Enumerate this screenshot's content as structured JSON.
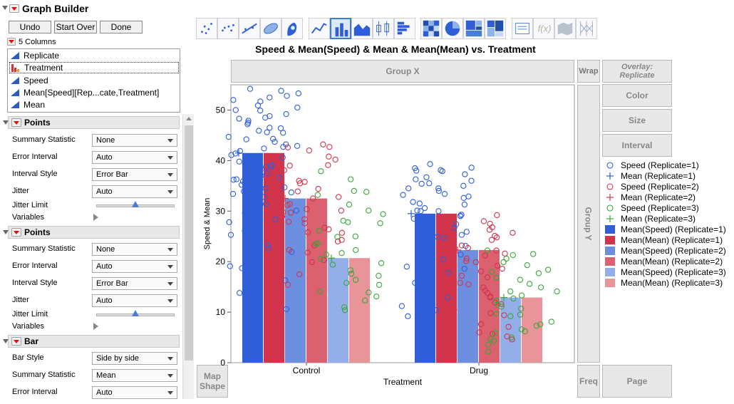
{
  "window": {
    "title": "Graph Builder"
  },
  "buttons": {
    "undo": "Undo",
    "start_over": "Start Over",
    "done": "Done"
  },
  "columns": {
    "header": "5 Columns",
    "items": [
      "Replicate",
      "Treatment",
      "Speed",
      "Mean[Speed][Rep...cate,Treatment]",
      "Mean"
    ]
  },
  "sections": [
    {
      "title": "Points",
      "rows": [
        {
          "label": "Summary Statistic",
          "value": "None"
        },
        {
          "label": "Error Interval",
          "value": "Auto"
        },
        {
          "label": "Interval Style",
          "value": "Error Bar"
        },
        {
          "label": "Jitter",
          "value": "Auto"
        }
      ],
      "jitter_limit_label": "Jitter Limit",
      "jitter_limit_level": 0.5,
      "variables_label": "Variables"
    },
    {
      "title": "Points",
      "rows": [
        {
          "label": "Summary Statistic",
          "value": "None"
        },
        {
          "label": "Error Interval",
          "value": "Auto"
        },
        {
          "label": "Interval Style",
          "value": "Error Bar"
        },
        {
          "label": "Jitter",
          "value": "Auto"
        }
      ],
      "jitter_limit_label": "Jitter Limit",
      "jitter_limit_level": 0.5,
      "variables_label": "Variables"
    },
    {
      "title": "Bar",
      "rows": [
        {
          "label": "Bar Style",
          "value": "Side by side"
        },
        {
          "label": "Summary Statistic",
          "value": "Mean"
        },
        {
          "label": "Error Interval",
          "value": "Auto"
        }
      ]
    }
  ],
  "toolbar_icons": [
    "points-icon",
    "jitter-points-icon",
    "line-of-fit-icon",
    "ellipse-icon",
    "contour-icon",
    "line-icon",
    "bar-icon",
    "area-icon",
    "box-plot-icon",
    "histogram-icon",
    "heatmap-icon",
    "pie-icon",
    "treemap-icon",
    "mosaic-icon",
    "caption-box-icon",
    "formula-icon",
    "map-shapes-icon",
    "parallel-icon"
  ],
  "drop_zones": {
    "group_x": "Group X",
    "wrap": "Wrap",
    "overlay": "Overlay:",
    "overlay_value": "Replicate",
    "color": "Color",
    "size": "Size",
    "interval": "Interval",
    "group_y": "Group Y",
    "map_shape_line1": "Map",
    "map_shape_line2": "Shape",
    "freq": "Freq",
    "page": "Page"
  },
  "colors": {
    "blue1": "#2f5ed8",
    "red1": "#d1344b",
    "blue2": "#6e8fe0",
    "red2": "#db6070",
    "blue3": "#94aeea",
    "red3": "#e89499",
    "green": "#3aa63a"
  },
  "chart_data": {
    "type": "bar",
    "title": "Speed & Mean(Speed) & Mean & Mean(Mean) vs. Treatment",
    "xlabel": "Treatment",
    "ylabel": "Speed & Mean",
    "categories": [
      "Control",
      "Drug"
    ],
    "ylim": [
      0,
      55
    ],
    "yticks": [
      0,
      10,
      20,
      30,
      40,
      50
    ],
    "series": [
      {
        "name": "Mean(Speed) (Replicate=1)",
        "values": [
          41.5,
          29.5
        ]
      },
      {
        "name": "Mean(Mean) (Replicate=1)",
        "values": [
          41.5,
          29.5
        ]
      },
      {
        "name": "Mean(Speed) (Replicate=2)",
        "values": [
          32.5,
          22.3
        ]
      },
      {
        "name": "Mean(Mean) (Replicate=2)",
        "values": [
          32.5,
          22.3
        ]
      },
      {
        "name": "Mean(Speed) (Replicate=3)",
        "values": [
          20.7,
          12.9
        ]
      },
      {
        "name": "Mean(Mean) (Replicate=3)",
        "values": [
          20.7,
          12.9
        ]
      }
    ],
    "points": [
      {
        "name": "Speed (Replicate=1)",
        "category": "Control",
        "values": [
          46.4,
          52.0,
          50.9,
          52.8,
          48.3,
          49.2,
          50.0,
          50.5,
          47.9,
          45.5,
          44.7,
          44.2,
          43.7,
          42.4,
          41.4,
          40.5,
          39.1,
          38.1,
          37.0,
          36.3,
          34.7,
          33.7,
          33.6,
          32.8,
          46.5,
          47.2,
          48.8,
          48.5,
          51.7,
          54.2,
          53.3,
          53.8,
          52.5,
          49.9,
          45.9,
          43.2,
          41.1,
          39.8,
          38.7,
          36.7,
          35.2,
          34.5,
          33.4,
          31.4,
          29.6,
          28.3,
          27.8,
          26.1,
          25.3,
          24.2,
          23.3,
          22.6,
          21.9,
          20.6,
          19.1,
          18.7,
          17.1,
          16.3,
          15.3,
          13.8,
          12.7,
          10.6,
          38.8,
          37.5,
          36.2,
          45.6,
          44.3,
          42.9,
          41.9,
          40.6,
          30.1,
          33.9,
          35.9,
          42.7,
          47.5
        ]
      },
      {
        "name": "Speed (Replicate=1)",
        "category": "Drug",
        "values": [
          38.1,
          36.7,
          35.4,
          34.0,
          34.5,
          33.2,
          37.3,
          38.5,
          39.3,
          38.6,
          36.3,
          34.5,
          32.9,
          31.3,
          31.5,
          30.0,
          29.1,
          27.9,
          29.3,
          28.1,
          27.4,
          27.3,
          26.7,
          25.9,
          24.9,
          24.7,
          22.2,
          21.4,
          20.4,
          19.0,
          17.8,
          15.8,
          14.4,
          12.9,
          11.2,
          10.4,
          9.2,
          37.9,
          38.0,
          36.0,
          35.5,
          32.6,
          31.8,
          30.6,
          30.0,
          28.5,
          26.6,
          25.3,
          23.1,
          19.8,
          18.6,
          33.4,
          35.0,
          30.1,
          29.0
        ]
      },
      {
        "name": "Mean (Replicate=1)",
        "category": "Control",
        "values": [
          41.5
        ]
      },
      {
        "name": "Mean (Replicate=1)",
        "category": "Drug",
        "values": [
          29.5
        ]
      },
      {
        "name": "Speed (Replicate=2)",
        "category": "Control",
        "values": [
          42.7,
          42.0,
          40.2,
          39.0,
          38.1,
          36.1,
          33.9,
          33.1,
          32.5,
          31.4,
          30.1,
          29.7,
          28.4,
          27.6,
          26.7,
          25.8,
          24.3,
          23.2,
          22.1,
          21.0,
          19.9,
          18.5,
          17.5,
          16.2,
          15.4,
          14.5,
          43.2,
          42.6,
          39.1,
          37.3,
          35.5,
          34.4,
          32.8,
          31.2,
          30.4,
          28.9,
          29.8,
          27.9,
          26.4,
          25.7,
          24.0,
          21.8,
          20.3,
          38.4,
          35.8,
          22.3,
          36.0,
          40.8
        ]
      },
      {
        "name": "Speed (Replicate=2)",
        "category": "Drug",
        "values": [
          29.2,
          28.0,
          26.8,
          25.7,
          24.3,
          23.2,
          22.2,
          21.2,
          20.1,
          19.2,
          18.1,
          17.2,
          15.8,
          14.9,
          13.8,
          12.9,
          11.6,
          10.5,
          9.4,
          8.2,
          7.1,
          6.0,
          5.2,
          4.1,
          3.0,
          25.1,
          26.3,
          27.5,
          22.7,
          19.9,
          17.5,
          15.5,
          13.1,
          11.9,
          9.8,
          7.6,
          5.7,
          4.6,
          21.6,
          20.6,
          24.8,
          26.5,
          28.5,
          18.6,
          16.9,
          14.3
        ]
      },
      {
        "name": "Mean (Replicate=2)",
        "category": "Control",
        "values": [
          32.5
        ]
      },
      {
        "name": "Mean (Replicate=2)",
        "category": "Drug",
        "values": [
          22.3
        ]
      },
      {
        "name": "Speed (Replicate=3)",
        "category": "Control",
        "values": [
          36.3,
          34.0,
          33.2,
          31.3,
          29.4,
          28.1,
          27.6,
          26.1,
          24.9,
          23.5,
          22.3,
          21.4,
          20.5,
          19.4,
          18.3,
          17.2,
          16.4,
          15.4,
          14.1,
          13.1,
          12.3,
          11.0,
          10.4,
          37.9,
          33.8,
          30.1,
          27.8,
          25.0,
          23.6,
          21.7,
          19.7,
          17.6,
          15.8,
          13.9
        ]
      },
      {
        "name": "Speed (Replicate=3)",
        "category": "Drug",
        "values": [
          22.2,
          21.3,
          20.6,
          19.3,
          18.4,
          17.7,
          16.8,
          15.6,
          14.9,
          14.1,
          13.3,
          12.3,
          11.5,
          10.7,
          9.7,
          9.2,
          8.1,
          7.3,
          6.6,
          5.9,
          5.0,
          4.3,
          3.6,
          2.2,
          21.5,
          19.9,
          18.0,
          16.4,
          14.1,
          12.7,
          11.1,
          9.5,
          7.6,
          6.2,
          4.7
        ]
      },
      {
        "name": "Mean (Replicate=3)",
        "category": "Control",
        "values": [
          20.7
        ]
      },
      {
        "name": "Mean (Replicate=3)",
        "category": "Drug",
        "values": [
          12.9
        ]
      }
    ],
    "legend_position": "right",
    "legend": [
      {
        "label": "Speed (Replicate=1)",
        "symbol": "circle",
        "color": "#2f5ed8"
      },
      {
        "label": "Mean (Replicate=1)",
        "symbol": "plus",
        "color": "#2f5ed8"
      },
      {
        "label": "Speed (Replicate=2)",
        "symbol": "circle",
        "color": "#d1344b"
      },
      {
        "label": "Mean (Replicate=2)",
        "symbol": "plus",
        "color": "#d1344b"
      },
      {
        "label": "Speed (Replicate=3)",
        "symbol": "circle",
        "color": "#3aa63a"
      },
      {
        "label": "Mean (Replicate=3)",
        "symbol": "plus",
        "color": "#3aa63a"
      },
      {
        "label": "Mean(Speed) (Replicate=1)",
        "symbol": "box",
        "color": "#2f5ed8"
      },
      {
        "label": "Mean(Mean) (Replicate=1)",
        "symbol": "box",
        "color": "#d1344b"
      },
      {
        "label": "Mean(Speed) (Replicate=2)",
        "symbol": "box",
        "color": "#6e8fe0"
      },
      {
        "label": "Mean(Mean) (Replicate=2)",
        "symbol": "box",
        "color": "#db6070"
      },
      {
        "label": "Mean(Speed) (Replicate=3)",
        "symbol": "box",
        "color": "#94aeea"
      },
      {
        "label": "Mean(Mean) (Replicate=3)",
        "symbol": "box",
        "color": "#e89499"
      }
    ]
  }
}
